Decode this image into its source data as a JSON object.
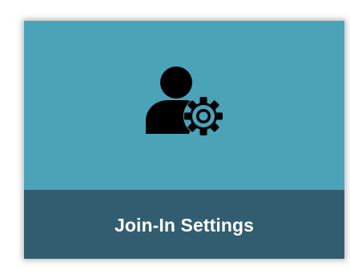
{
  "tile": {
    "label": "Join-In Settings",
    "icon": "user-settings-icon",
    "colors": {
      "top": "#4ba3b8",
      "bottom": "#325d70",
      "label": "#ffffff",
      "icon": "#000000"
    }
  }
}
